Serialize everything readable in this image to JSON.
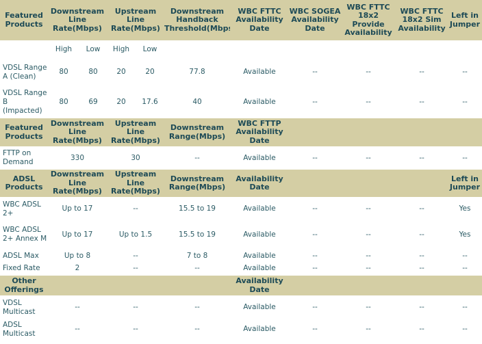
{
  "header1": {
    "col0": "Featured Products",
    "col1": "Downstream Line Rate(Mbps)",
    "col2": "Upstream Line Rate(Mbps)",
    "col3": "Downstream Handback Threshold(Mbps)",
    "col4": "WBC FTTC Availability Date",
    "col5": "WBC SOGEA Availability Date",
    "col6": "WBC FTTC 18x2 Provide Availability",
    "col7": "WBC FTTC 18x2 Sim Availability",
    "col8": "Left in Jumper"
  },
  "subheader": {
    "high1": "High",
    "low1": "Low",
    "high2": "High",
    "low2": "Low"
  },
  "vdsl_rows": [
    {
      "name": "VDSL Range A (Clean)",
      "dh": "80",
      "dl": "80",
      "uh": "20",
      "ul": "20",
      "threshold": "77.8",
      "fttc": "Available",
      "sogea": "--",
      "provide": "--",
      "sim": "--",
      "jumper": "--"
    },
    {
      "name": "VDSL Range B (Impacted)",
      "dh": "80",
      "dl": "69",
      "uh": "20",
      "ul": "17.6",
      "threshold": "40",
      "fttc": "Available",
      "sogea": "--",
      "provide": "--",
      "sim": "--",
      "jumper": "--"
    }
  ],
  "header2": {
    "col0": "Featured Products",
    "col1": "Downstream Line Rate(Mbps)",
    "col2": "Upstream Line Rate(Mbps)",
    "col3": "Downstream Range(Mbps)",
    "col4": "WBC FTTP Availability Date"
  },
  "fttp_row": {
    "name": "FTTP on Demand",
    "down": "330",
    "up": "30",
    "range": "--",
    "avail": "Available",
    "sogea": "--",
    "provide": "--",
    "sim": "--",
    "jumper": "--"
  },
  "header3": {
    "col0": "ADSL Products",
    "col1": "Downstream Line Rate(Mbps)",
    "col2": "Upstream Line Rate(Mbps)",
    "col3": "Downstream Range(Mbps)",
    "col4": "Availability Date",
    "col8": "Left in Jumper"
  },
  "adsl_rows": [
    {
      "name": "WBC ADSL 2+",
      "down": "Up to 17",
      "up": "--",
      "range": "15.5 to 19",
      "avail": "Available",
      "sogea": "--",
      "provide": "--",
      "sim": "--",
      "jumper": "Yes"
    },
    {
      "name": "WBC ADSL 2+ Annex M",
      "down": "Up to 17",
      "up": "Up to 1.5",
      "range": "15.5 to 19",
      "avail": "Available",
      "sogea": "--",
      "provide": "--",
      "sim": "--",
      "jumper": "Yes"
    },
    {
      "name": "ADSL Max",
      "down": "Up to 8",
      "up": "--",
      "range": "7 to 8",
      "avail": "Available",
      "sogea": "--",
      "provide": "--",
      "sim": "--",
      "jumper": "--"
    },
    {
      "name": "Fixed Rate",
      "down": "2",
      "up": "--",
      "range": "--",
      "avail": "Available",
      "sogea": "--",
      "provide": "--",
      "sim": "--",
      "jumper": "--"
    }
  ],
  "header4": {
    "col0": "Other Offerings",
    "col4": "Availability Date"
  },
  "other_rows": [
    {
      "name": "VDSL Multicast",
      "c1": "--",
      "c2": "--",
      "c3": "--",
      "avail": "Available",
      "sogea": "--",
      "provide": "--",
      "sim": "--",
      "jumper": "--"
    },
    {
      "name": "ADSL Multicast",
      "c1": "--",
      "c2": "--",
      "c3": "--",
      "avail": "Available",
      "sogea": "--",
      "provide": "--",
      "sim": "--",
      "jumper": "--"
    }
  ]
}
